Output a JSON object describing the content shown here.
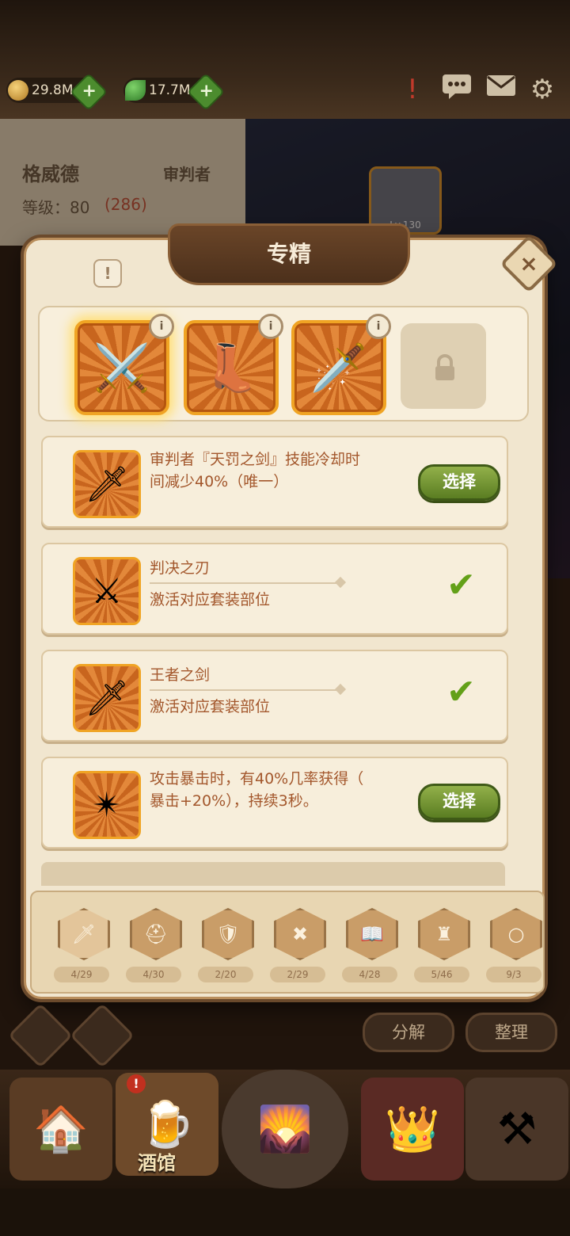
{
  "top_bar": {
    "coins": "29.8M",
    "gems": "17.7M",
    "icons": [
      "alert-icon",
      "chat-icon",
      "mail-icon",
      "settings-icon"
    ]
  },
  "hero": {
    "name": "格威德",
    "class": "审判者",
    "level_label": "等级：80",
    "level_extra": "(286)",
    "portrait_level": "Lv.130"
  },
  "modal": {
    "title": "专精",
    "close": "×",
    "info": "!"
  },
  "equipment": [
    {
      "name": "sword",
      "icon": "⚔",
      "selected": true
    },
    {
      "name": "boot",
      "icon": "👢",
      "selected": false
    },
    {
      "name": "blade",
      "icon": "🗡",
      "selected": false
    },
    {
      "name": "locked",
      "icon": "lock",
      "selected": false
    }
  ],
  "options": [
    {
      "line1": "审判者『天罚之剑』技能冷却时",
      "line2": "间减少40%（唯一）",
      "action": "选择",
      "done": false
    },
    {
      "title": "判决之刃",
      "subtitle": "激活对应套装部位",
      "done": true
    },
    {
      "title": "王者之剑",
      "subtitle": "激活对应套装部位",
      "done": true
    },
    {
      "line1": "攻击暴击时，有40%几率获得（",
      "line2": "暴击+20%），持续3秒。",
      "action": "选择",
      "done": false
    }
  ],
  "categories": [
    {
      "icon": "weapon-icon",
      "count": "4/29"
    },
    {
      "icon": "helmet-icon",
      "count": "4/30"
    },
    {
      "icon": "armor-icon",
      "count": "2/20"
    },
    {
      "icon": "shield-icon",
      "count": "2/29"
    },
    {
      "icon": "book-icon",
      "count": "4/28"
    },
    {
      "icon": "pauldron-icon",
      "count": "5/46"
    },
    {
      "icon": "ring-icon",
      "count": "9/3"
    }
  ],
  "actions": {
    "decompose": "分解",
    "organize": "整理"
  },
  "nav": {
    "active_label": "酒馆"
  }
}
